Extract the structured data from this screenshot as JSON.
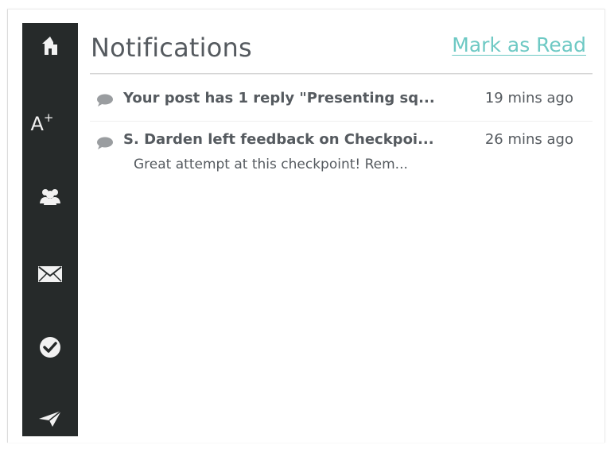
{
  "panel": {
    "title": "Notifications",
    "mark_read_label": "Mark as Read"
  },
  "sidebar": {
    "items": [
      {
        "icon": "home-icon"
      },
      {
        "icon": "grades-icon",
        "label_main": "A",
        "label_sup": "+"
      },
      {
        "icon": "group-icon"
      },
      {
        "icon": "mail-icon"
      },
      {
        "icon": "checkmark-icon",
        "active": true
      },
      {
        "icon": "send-icon"
      }
    ]
  },
  "notifications": [
    {
      "text": "Your post has 1 reply \"Presenting sq...",
      "time": "19 mins ago"
    },
    {
      "text": "S. Darden left feedback on Checkpoi...",
      "time": "26 mins ago",
      "subtext": "Great attempt at this checkpoint! Rem..."
    }
  ],
  "colors": {
    "sidebar_bg": "#262a2a",
    "accent": "#6ec9c4",
    "text": "#555a5f"
  }
}
